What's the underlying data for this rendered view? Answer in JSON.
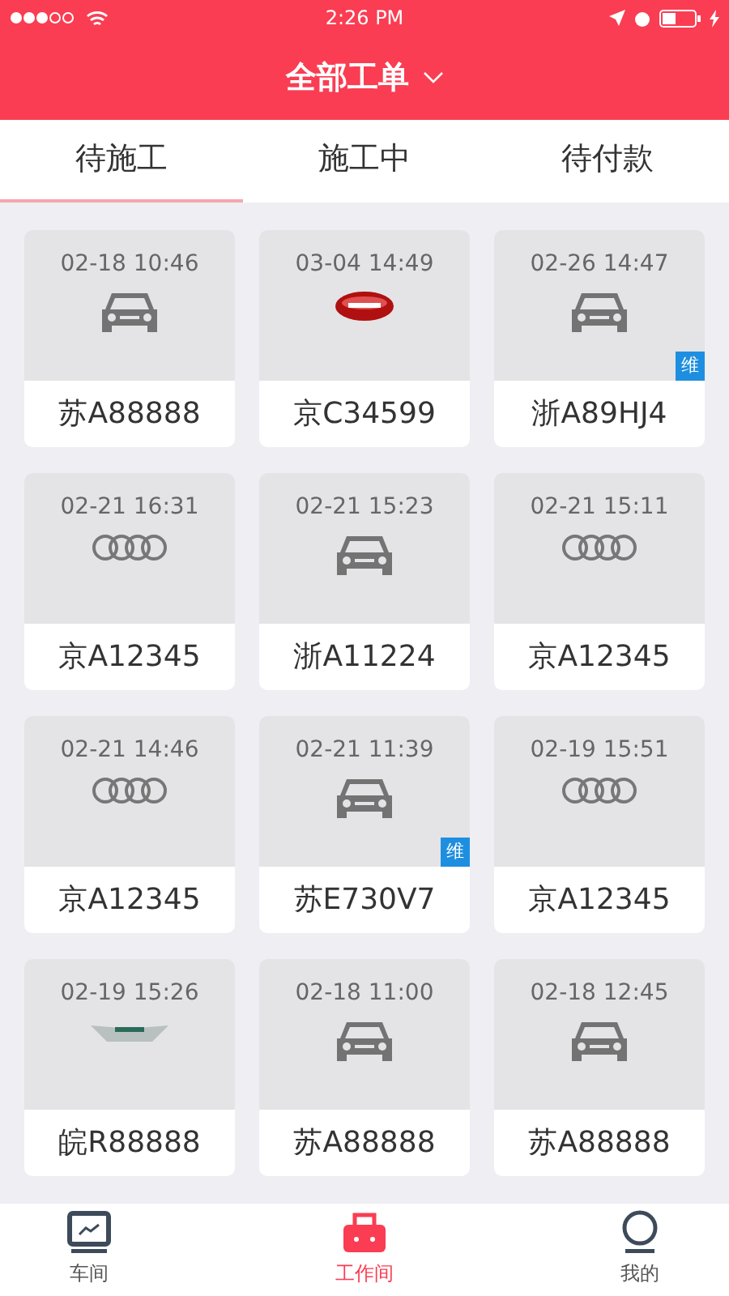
{
  "status_bar": {
    "time": "2:26 PM"
  },
  "header": {
    "title": "全部工单"
  },
  "tabs": [
    {
      "label": "待施工",
      "selected": true
    },
    {
      "label": "施工中",
      "selected": false
    },
    {
      "label": "待付款",
      "selected": false
    }
  ],
  "orders": [
    {
      "time": "02-18 10:46",
      "kind": "car",
      "plate": "苏A88888"
    },
    {
      "time": "03-04 14:49",
      "kind": "oval",
      "plate": "京C34599"
    },
    {
      "time": "02-26 14:47",
      "kind": "car",
      "plate": "浙A89HJ4",
      "tag": "维"
    },
    {
      "time": "02-21 16:31",
      "kind": "rings",
      "plate": "京A12345"
    },
    {
      "time": "02-21 15:23",
      "kind": "car",
      "plate": "浙A11224"
    },
    {
      "time": "02-21 15:11",
      "kind": "rings",
      "plate": "京A12345"
    },
    {
      "time": "02-21 14:46",
      "kind": "rings",
      "plate": "京A12345"
    },
    {
      "time": "02-21 11:39",
      "kind": "car",
      "plate": "苏E730V7",
      "tag": "维"
    },
    {
      "time": "02-19 15:51",
      "kind": "rings",
      "plate": "京A12345"
    },
    {
      "time": "02-19 15:26",
      "kind": "wings",
      "plate": "皖R88888"
    },
    {
      "time": "02-18 11:00",
      "kind": "car",
      "plate": "苏A88888"
    },
    {
      "time": "02-18 12:45",
      "kind": "car",
      "plate": "苏A88888"
    }
  ],
  "nav": [
    {
      "label": "车间",
      "kind": "monitor",
      "selected": false
    },
    {
      "label": "工作间",
      "kind": "toolbox",
      "selected": true
    },
    {
      "label": "我的",
      "kind": "person",
      "selected": false
    }
  ]
}
